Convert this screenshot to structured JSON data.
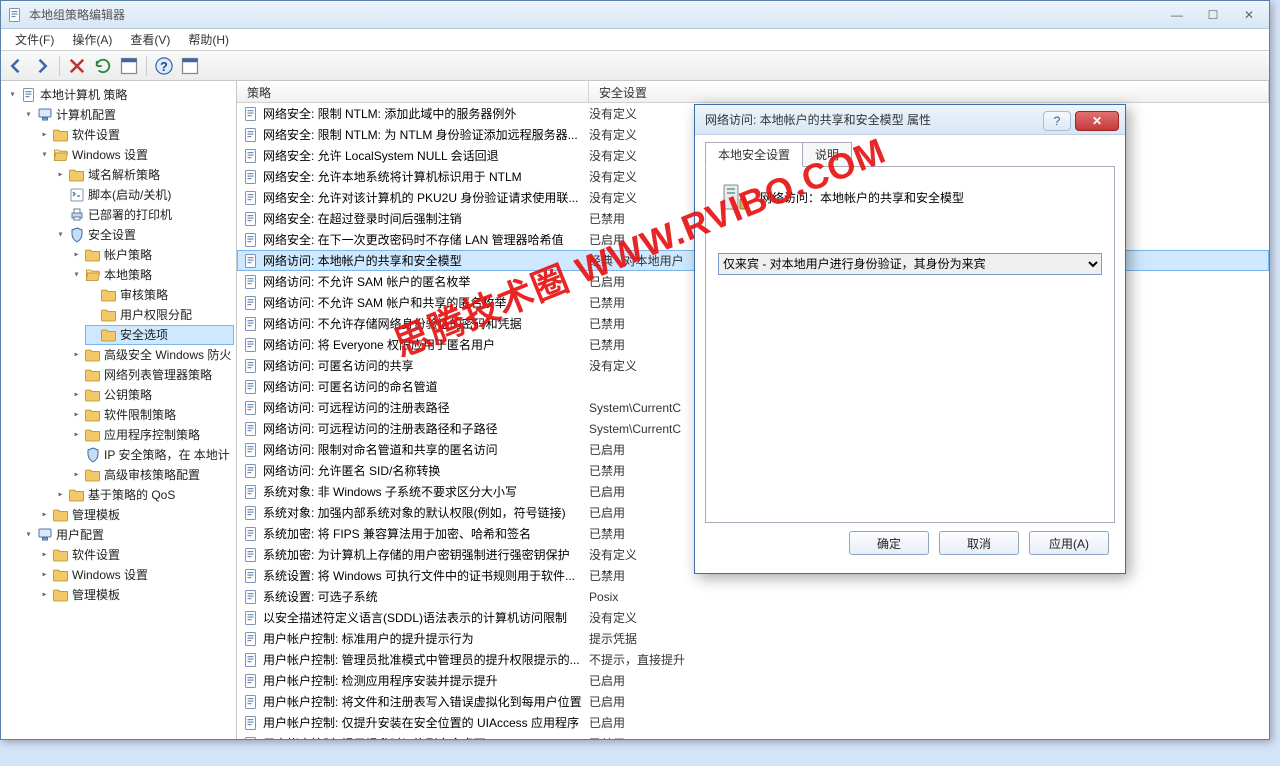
{
  "app": {
    "title": "本地组策略编辑器"
  },
  "menu": {
    "file": "文件(F)",
    "action": "操作(A)",
    "view": "查看(V)",
    "help": "帮助(H)"
  },
  "tree": {
    "root": "本地计算机 策略",
    "cc": "计算机配置",
    "sw1": "软件设置",
    "ws": "Windows 设置",
    "nrp": "域名解析策略",
    "script": "脚本(启动/关机)",
    "printers": "已部署的打印机",
    "sec": "安全设置",
    "acct": "帐户策略",
    "local": "本地策略",
    "audit": "审核策略",
    "ura": "用户权限分配",
    "secopt": "安全选项",
    "wfw": "高级安全 Windows 防火",
    "nlep": "网络列表管理器策略",
    "pk": "公钥策略",
    "srp": "软件限制策略",
    "apcp": "应用程序控制策略",
    "ipsec": "IP 安全策略，在 本地计",
    "aadv": "高级审核策略配置",
    "qos": "基于策略的 QoS",
    "tmpl1": "管理模板",
    "uc": "用户配置",
    "sw2": "软件设置",
    "ws2": "Windows 设置",
    "tmpl2": "管理模板"
  },
  "cols": {
    "policy": "策略",
    "setting": "安全设置"
  },
  "policies": [
    {
      "n": "网络安全: 限制 NTLM: 添加此域中的服务器例外",
      "v": "没有定义"
    },
    {
      "n": "网络安全: 限制 NTLM: 为 NTLM 身份验证添加远程服务器...",
      "v": "没有定义"
    },
    {
      "n": "网络安全: 允许 LocalSystem NULL 会话回退",
      "v": "没有定义"
    },
    {
      "n": "网络安全: 允许本地系统将计算机标识用于 NTLM",
      "v": "没有定义"
    },
    {
      "n": "网络安全: 允许对该计算机的 PKU2U 身份验证请求使用联...",
      "v": "没有定义"
    },
    {
      "n": "网络安全: 在超过登录时间后强制注销",
      "v": "已禁用"
    },
    {
      "n": "网络安全: 在下一次更改密码时不存储 LAN 管理器哈希值",
      "v": "已启用"
    },
    {
      "n": "网络访问: 本地帐户的共享和安全模型",
      "v": "经典 - 对本地用户",
      "sel": true
    },
    {
      "n": "网络访问: 不允许 SAM 帐户的匿名枚举",
      "v": "已启用"
    },
    {
      "n": "网络访问: 不允许 SAM 帐户和共享的匿名枚举",
      "v": "已禁用"
    },
    {
      "n": "网络访问: 不允许存储网络身份验证的密码和凭据",
      "v": "已禁用"
    },
    {
      "n": "网络访问: 将 Everyone 权限应用于匿名用户",
      "v": "已禁用"
    },
    {
      "n": "网络访问: 可匿名访问的共享",
      "v": "没有定义"
    },
    {
      "n": "网络访问: 可匿名访问的命名管道",
      "v": ""
    },
    {
      "n": "网络访问: 可远程访问的注册表路径",
      "v": "System\\CurrentC"
    },
    {
      "n": "网络访问: 可远程访问的注册表路径和子路径",
      "v": "System\\CurrentC"
    },
    {
      "n": "网络访问: 限制对命名管道和共享的匿名访问",
      "v": "已启用"
    },
    {
      "n": "网络访问: 允许匿名 SID/名称转换",
      "v": "已禁用"
    },
    {
      "n": "系统对象: 非 Windows 子系统不要求区分大小写",
      "v": "已启用"
    },
    {
      "n": "系统对象: 加强内部系统对象的默认权限(例如，符号链接)",
      "v": "已启用"
    },
    {
      "n": "系统加密: 将 FIPS 兼容算法用于加密、哈希和签名",
      "v": "已禁用"
    },
    {
      "n": "系统加密: 为计算机上存储的用户密钥强制进行强密钥保护",
      "v": "没有定义"
    },
    {
      "n": "系统设置: 将 Windows 可执行文件中的证书规则用于软件...",
      "v": "已禁用"
    },
    {
      "n": "系统设置: 可选子系统",
      "v": "Posix"
    },
    {
      "n": "以安全描述符定义语言(SDDL)语法表示的计算机访问限制",
      "v": "没有定义"
    },
    {
      "n": "用户帐户控制: 标准用户的提升提示行为",
      "v": "提示凭据"
    },
    {
      "n": "用户帐户控制: 管理员批准模式中管理员的提升权限提示的...",
      "v": "不提示，直接提升"
    },
    {
      "n": "用户帐户控制: 检测应用程序安装并提示提升",
      "v": "已启用"
    },
    {
      "n": "用户帐户控制: 将文件和注册表写入错误虚拟化到每用户位置",
      "v": "已启用"
    },
    {
      "n": "用户帐户控制: 仅提升安装在安全位置的 UIAccess 应用程序",
      "v": "已启用"
    },
    {
      "n": "用户帐户控制: 提示提升时切换到安全桌面",
      "v": "已禁用"
    }
  ],
  "dialog": {
    "title": "网络访问: 本地帐户的共享和安全模型 属性",
    "tab1": "本地安全设置",
    "tab2": "说明",
    "heading": "网络访问：本地帐户的共享和安全模型",
    "option": "仅来宾 - 对本地用户进行身份验证，其身份为来宾",
    "ok": "确定",
    "cancel": "取消",
    "apply": "应用(A)"
  },
  "watermark": "思腾技术圈 WWW.RVIBO.COM"
}
